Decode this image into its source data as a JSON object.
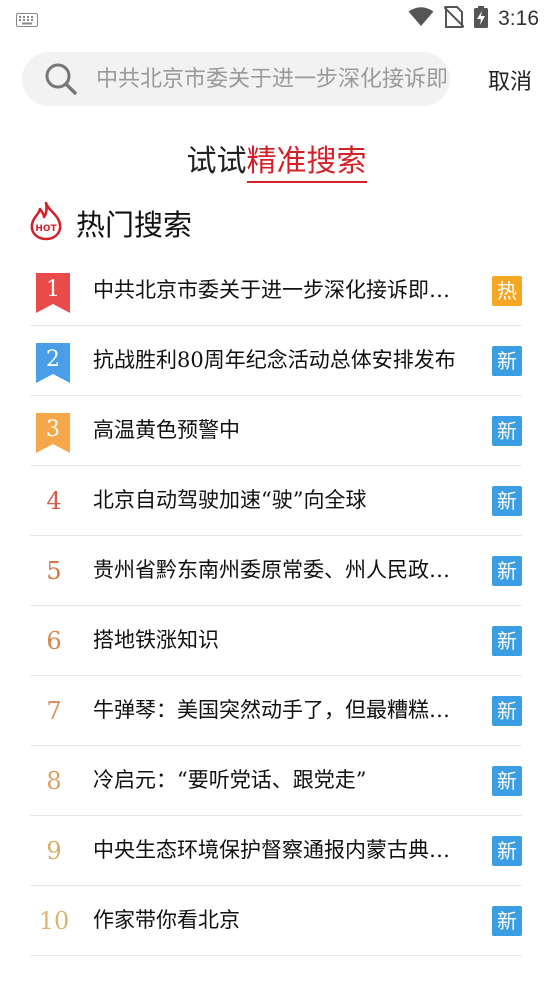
{
  "status": {
    "time": "3:16"
  },
  "search": {
    "placeholder": "中共北京市委关于进一步深化接诉即办改革工作的意见",
    "cancel_label": "取消"
  },
  "precise": {
    "prefix": "试试",
    "link": "精准搜索"
  },
  "hot": {
    "title": "热门搜索",
    "icon_text": "HOT",
    "items": [
      {
        "rank": "1",
        "title": "中共北京市委关于进一步深化接诉即办改革工作的意见",
        "badge": "热"
      },
      {
        "rank": "2",
        "title": "抗战胜利80周年纪念活动总体安排发布",
        "badge": "新"
      },
      {
        "rank": "3",
        "title": "高温黄色预警中",
        "badge": "新"
      },
      {
        "rank": "4",
        "title": "北京自动驾驶加速“驶”向全球",
        "badge": "新"
      },
      {
        "rank": "5",
        "title": "贵州省黔东南州委原常委、州人民政府原副州长被查",
        "badge": "新"
      },
      {
        "rank": "6",
        "title": "搭地铁涨知识",
        "badge": "新"
      },
      {
        "rank": "7",
        "title": "牛弹琴：美国突然动手了，但最糟糕的可能还在后面",
        "badge": "新"
      },
      {
        "rank": "8",
        "title": "冷启元：“要听党话、跟党走”",
        "badge": "新"
      },
      {
        "rank": "9",
        "title": "中央生态环境保护督察通报内蒙古典型案例",
        "badge": "新"
      },
      {
        "rank": "10",
        "title": "作家带你看北京",
        "badge": "新"
      }
    ]
  },
  "colors": {
    "accent_red": "#d3212a",
    "rank1": "#e94b4b",
    "rank2": "#4a9de8",
    "rank3": "#f5a74a",
    "badge_hot": "#f5a623",
    "badge_new": "#3b9de4"
  }
}
